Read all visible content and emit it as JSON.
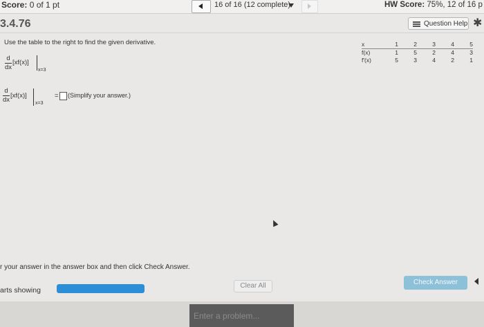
{
  "header": {
    "score_label": "Score:",
    "score_value": "0 of 1 pt",
    "nav_progress": "16 of 16 (12 complete)",
    "hw_score_label": "HW Score:",
    "hw_score_value": "75%, 12 of 16 p"
  },
  "section": {
    "title": "3.4.76",
    "question_help": "Question Help"
  },
  "question": {
    "instruction": "Use the table to the right to find the given derivative.",
    "d": "d",
    "dx": "dx",
    "expression": "[xf(x)]",
    "eval_at": "x=3",
    "equals": "=",
    "answer_value": "",
    "simplify_note": "(Simplify your answer.)"
  },
  "table": {
    "header": [
      "x",
      "1",
      "2",
      "3",
      "4",
      "5"
    ],
    "rows": [
      [
        "f(x)",
        "1",
        "5",
        "2",
        "4",
        "3"
      ],
      [
        "f'(x)",
        "5",
        "3",
        "4",
        "2",
        "1"
      ]
    ]
  },
  "footer": {
    "hint": "r your answer in the answer box and then click Check Answer.",
    "parts_label": "arts showing",
    "parts_progress": 1.0,
    "clear_all": "Clear All",
    "check_answer": "Check Answer",
    "search_placeholder": "Enter a problem..."
  },
  "colors": {
    "progress": "#2b8ed6",
    "check_button": "#8dc1da"
  }
}
